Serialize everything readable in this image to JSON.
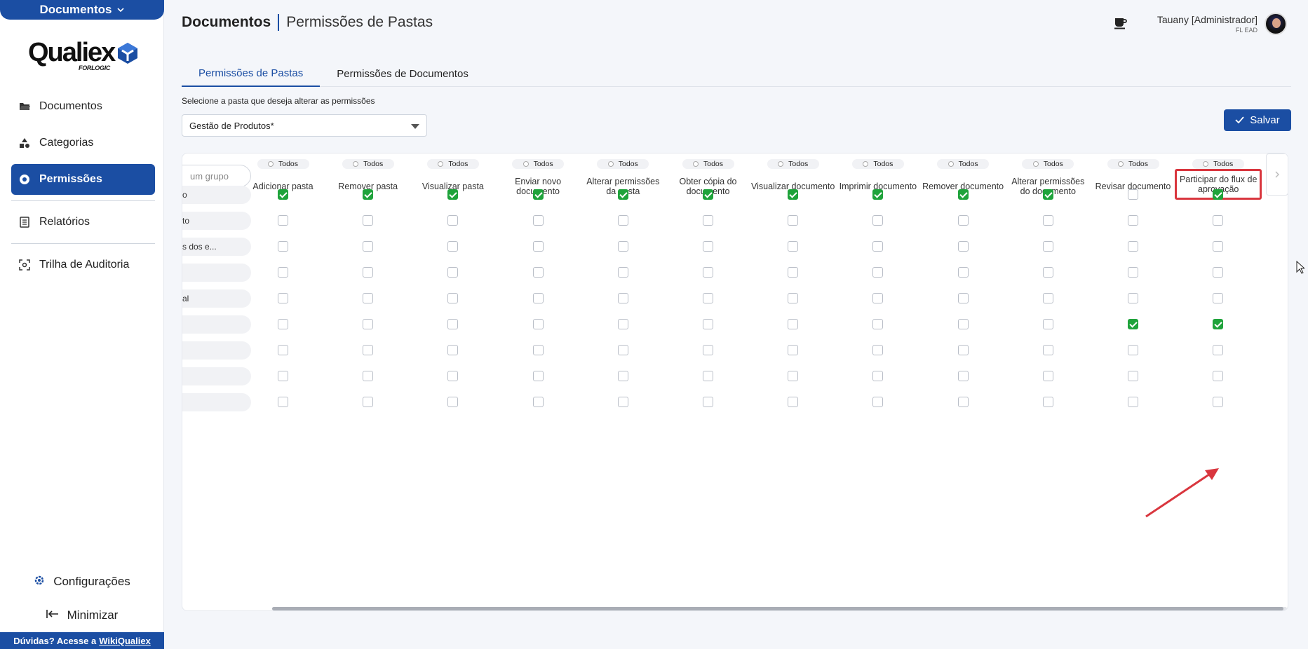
{
  "sidebar": {
    "module": "Documentos",
    "logo": "Qualiex",
    "logo_sub": "FORLOGIC",
    "items": [
      {
        "label": "Documentos",
        "icon": "folder-open-icon"
      },
      {
        "label": "Categorias",
        "icon": "shapes-icon"
      },
      {
        "label": "Permissões",
        "icon": "record-icon",
        "active": true
      },
      {
        "label": "Relatórios",
        "icon": "report-icon"
      },
      {
        "label": "Trilha de Auditoria",
        "icon": "audit-icon"
      }
    ],
    "settings": "Configurações",
    "minimize": "Minimizar",
    "help_prefix": "Dúvidas? Acesse a",
    "help_link": "WikiQualiex"
  },
  "header": {
    "title": "Documentos",
    "subtitle": "Permissões de Pastas",
    "user": "Tauany [Administrador]",
    "org": "FL EAD"
  },
  "tabs": [
    "Permissões de Pastas",
    "Permissões de Documentos"
  ],
  "folder_select": {
    "label": "Selecione a pasta que deseja alterar as permissões",
    "value": "Gestão de Produtos*"
  },
  "save_label": "Salvar",
  "table": {
    "group_search_placeholder": "um grupo",
    "todos_label": "Todos",
    "columns": [
      "Adicionar pasta",
      "Remover pasta",
      "Visualizar pasta",
      "Enviar novo documento",
      "Alterar permissões da pasta",
      "Obter cópia do documento",
      "Visualizar documento",
      "Imprimir documento",
      "Remover documento",
      "Alterar permissões do documento",
      "Revisar documento",
      "Participar do flux de aprovação"
    ],
    "rows": [
      {
        "name": "o",
        "checks": [
          1,
          1,
          1,
          1,
          1,
          1,
          1,
          1,
          1,
          1,
          0,
          1
        ]
      },
      {
        "name": "to",
        "checks": [
          0,
          0,
          0,
          0,
          0,
          0,
          0,
          0,
          0,
          0,
          0,
          0
        ]
      },
      {
        "name": "s dos e...",
        "checks": [
          0,
          0,
          0,
          0,
          0,
          0,
          0,
          0,
          0,
          0,
          0,
          0
        ]
      },
      {
        "name": "",
        "checks": [
          0,
          0,
          0,
          0,
          0,
          0,
          0,
          0,
          0,
          0,
          0,
          0
        ]
      },
      {
        "name": "al",
        "checks": [
          0,
          0,
          0,
          0,
          0,
          0,
          0,
          0,
          0,
          0,
          0,
          0
        ]
      },
      {
        "name": "",
        "checks": [
          0,
          0,
          0,
          0,
          0,
          0,
          0,
          0,
          0,
          0,
          1,
          1
        ]
      },
      {
        "name": "",
        "checks": [
          0,
          0,
          0,
          0,
          0,
          0,
          0,
          0,
          0,
          0,
          0,
          0
        ]
      },
      {
        "name": "",
        "checks": [
          0,
          0,
          0,
          0,
          0,
          0,
          0,
          0,
          0,
          0,
          0,
          0
        ]
      },
      {
        "name": "",
        "checks": [
          0,
          0,
          0,
          0,
          0,
          0,
          0,
          0,
          0,
          0,
          0,
          0
        ]
      }
    ]
  },
  "colors": {
    "brand": "#1b4ea3",
    "checked": "#1fa33b",
    "highlight": "#d9363e"
  }
}
